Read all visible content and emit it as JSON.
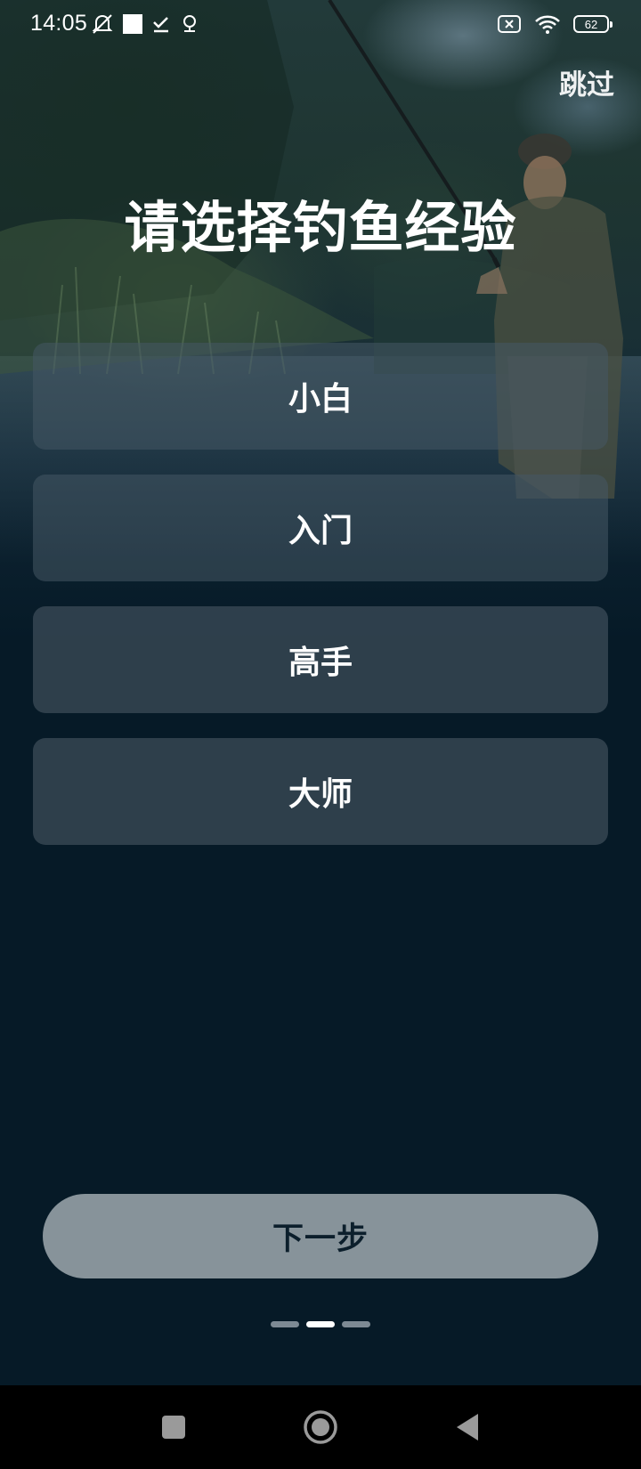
{
  "status_bar": {
    "time": "14:05",
    "battery_level": "62",
    "icons_left": [
      "mute-icon",
      "square-notification-icon",
      "check-download-icon",
      "location-icon"
    ],
    "icons_right": [
      "sim-error-icon",
      "wifi-icon",
      "battery-icon"
    ]
  },
  "header": {
    "skip_label": "跳过"
  },
  "main": {
    "title": "请选择钓鱼经验",
    "options": [
      {
        "label": "小白"
      },
      {
        "label": "入门"
      },
      {
        "label": "高手"
      },
      {
        "label": "大师"
      }
    ],
    "next_label": "下一步"
  },
  "pager": {
    "total": 3,
    "active_index": 1
  },
  "nav_bar": {
    "buttons": [
      "recent-apps",
      "home",
      "back"
    ]
  },
  "colors": {
    "background": "#061a27",
    "option_bg": "#465864",
    "next_button_bg": "#87939a",
    "next_button_text": "#0c1f2c"
  }
}
